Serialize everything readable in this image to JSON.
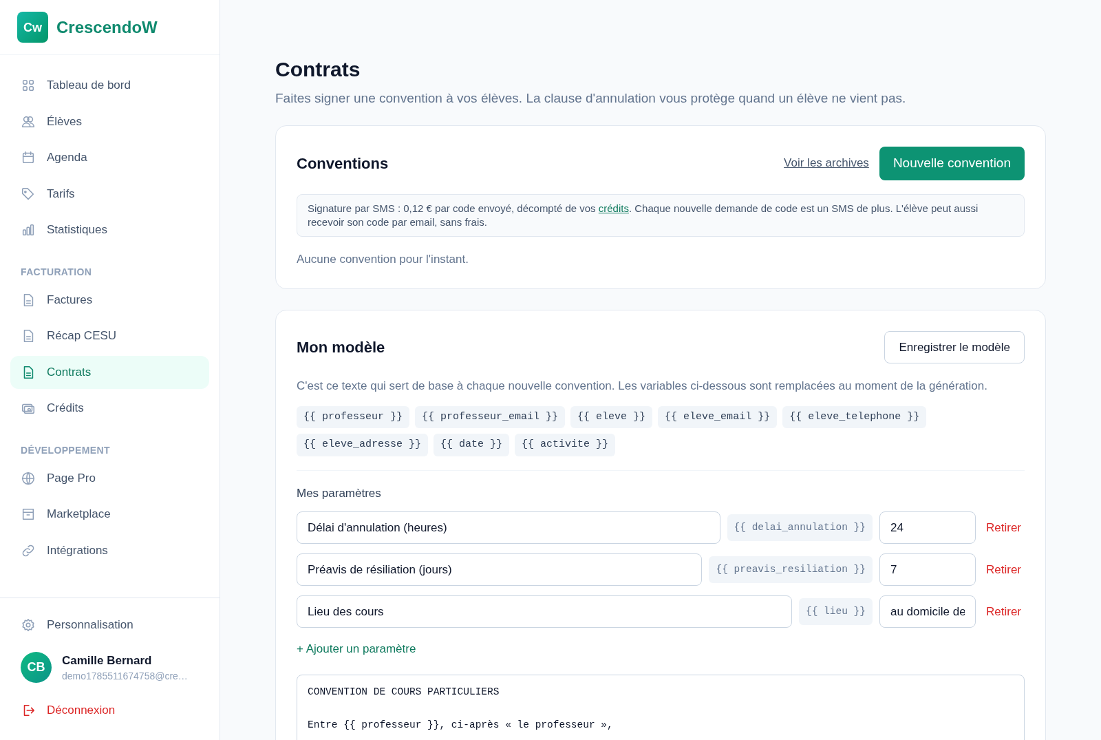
{
  "brand": {
    "logo": "Cw",
    "name": "CrescendoW"
  },
  "nav": [
    {
      "label": "Tableau de bord",
      "selected": false
    },
    {
      "label": "Élèves",
      "selected": false
    },
    {
      "label": "Agenda",
      "selected": false
    },
    {
      "label": "Tarifs",
      "selected": false
    },
    {
      "label": "Statistiques",
      "selected": false
    }
  ],
  "sections": [
    {
      "title": "FACTURATION",
      "items": [
        {
          "label": "Factures",
          "selected": false
        },
        {
          "label": "Récap CESU",
          "selected": false
        },
        {
          "label": "Contrats",
          "selected": true
        },
        {
          "label": "Crédits",
          "selected": false
        }
      ]
    },
    {
      "title": "DÉVELOPPEMENT",
      "items": [
        {
          "label": "Page Pro",
          "selected": false
        },
        {
          "label": "Marketplace",
          "selected": false
        },
        {
          "label": "Intégrations",
          "selected": false
        }
      ]
    }
  ],
  "footer": {
    "settings": "Personnalisation",
    "user": {
      "initials": "CB",
      "name": "Camille Bernard",
      "email": "demo1785511674758@cre…"
    },
    "logout": "Déconnexion"
  },
  "page": {
    "title": "Contrats",
    "subtitle": "Faites signer une convention à vos élèves. La clause d'annulation vous protège quand un élève ne vient pas."
  },
  "conventions": {
    "title": "Conventions",
    "archive_link": "Voir les archives",
    "new_button": "Nouvelle convention",
    "notice": {
      "before": "Signature par SMS : 0,12 € par code envoyé, décompté de vos ",
      "link": "crédits",
      "after": ". Chaque nouvelle demande de code est un SMS de plus. L'élève peut aussi recevoir son code par email, sans frais."
    },
    "empty": "Aucune convention pour l'instant."
  },
  "model": {
    "title": "Mon modèle",
    "save_button": "Enregistrer le modèle",
    "description": "C'est ce texte qui sert de base à chaque nouvelle convention. Les variables ci-dessous sont remplacées au moment de la génération.",
    "variables": [
      "{{ professeur }}",
      "{{ professeur_email }}",
      "{{ eleve }}",
      "{{ eleve_email }}",
      "{{ eleve_telephone }}",
      "{{ eleve_adresse }}",
      "{{ date }}",
      "{{ activite }}"
    ],
    "params_title": "Mes paramètres",
    "params": [
      {
        "label": "Délai d'annulation (heures)",
        "variable": "{{ delai_annulation }}",
        "value": "24",
        "remove": "Retirer"
      },
      {
        "label": "Préavis de résiliation (jours)",
        "variable": "{{ preavis_resiliation }}",
        "value": "7",
        "remove": "Retirer"
      },
      {
        "label": "Lieu des cours",
        "variable": "{{ lieu }}",
        "value": "au domicile de",
        "remove": "Retirer"
      }
    ],
    "add_param": "+ Ajouter un paramètre",
    "template": "CONVENTION DE COURS PARTICULIERS\n\nEntre {{ professeur }}, ci-après « le professeur »,"
  }
}
